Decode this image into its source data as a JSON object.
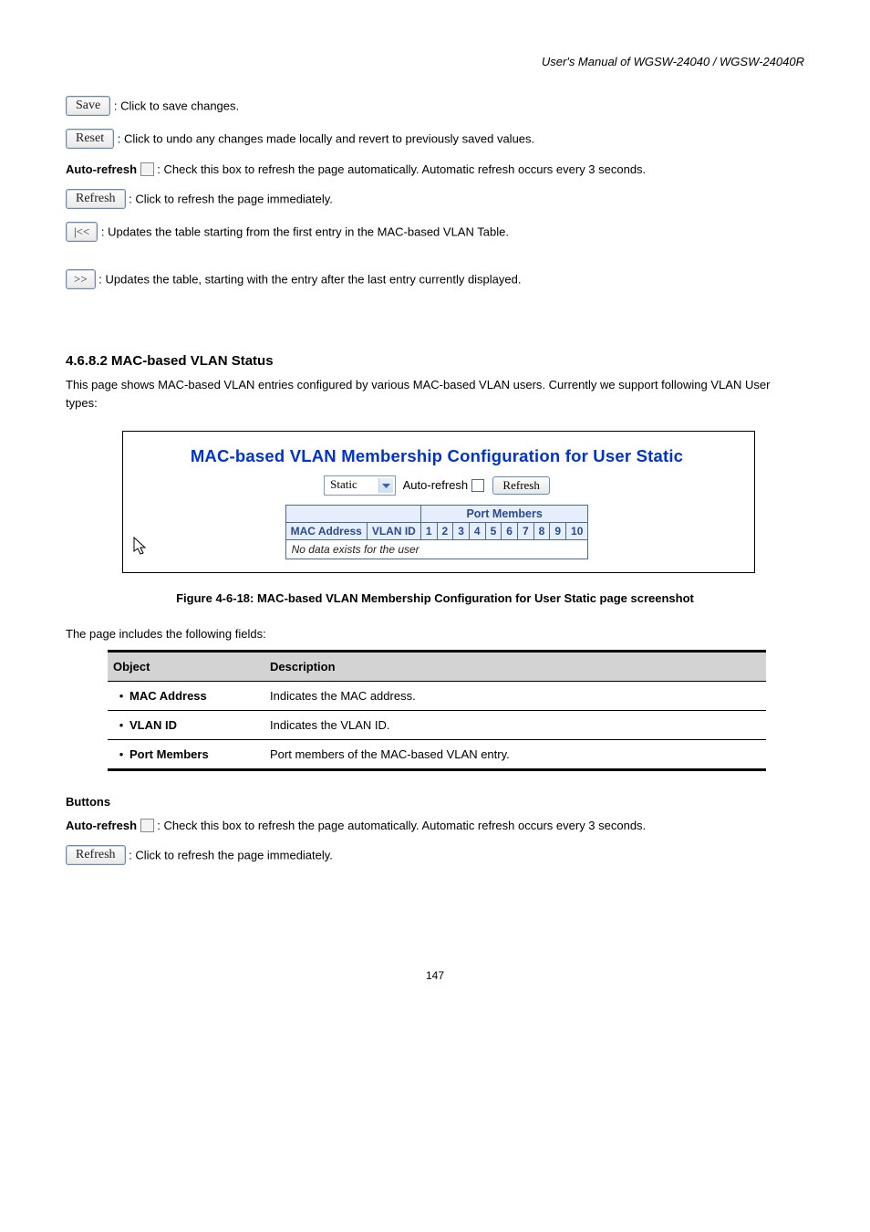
{
  "header": {
    "manual_line": "User's Manual of WGSW-24040 / WGSW-24040R"
  },
  "buttons_section": {
    "save_label": "Save",
    "save_desc": ": Click to save changes.",
    "reset_label": "Reset",
    "reset_desc": ": Click to undo any changes made locally and revert to previously saved values.",
    "autorefresh_label": "Auto-refresh",
    "autorefresh_desc": ": Check this box to refresh the page automatically. Automatic refresh occurs every 3 seconds.",
    "refresh_label": "Refresh",
    "refresh_desc": ": Click to refresh the page immediately.",
    "first_label": "|<<",
    "first_desc": ": Updates the table starting from the first entry in the MAC-based VLAN Table.",
    "next_label": ">>",
    "next_desc": ": Updates the table, starting with the entry after the last entry currently displayed."
  },
  "section": {
    "heading": "4.6.8.2 MAC-based VLAN Status",
    "para": "This page shows MAC-based VLAN entries configured by various MAC-based VLAN users. Currently we support following VLAN User types:",
    "figure_label": "Figure 4-6-18: MAC-based VLAN Membership Configuration for User Static page screenshot"
  },
  "figure": {
    "title": "MAC-based VLAN Membership Configuration for User Static",
    "select_value": "Static",
    "autorefresh_text": "Auto-refresh",
    "refresh_btn": "Refresh",
    "table": {
      "port_members_hdr": "Port Members",
      "mac_hdr": "MAC Address",
      "vlan_hdr": "VLAN ID",
      "ports": [
        "1",
        "2",
        "3",
        "4",
        "5",
        "6",
        "7",
        "8",
        "9",
        "10"
      ],
      "nodata": "No data exists for the user"
    }
  },
  "param_intro": "The page includes the following fields:",
  "param_table": {
    "hdr_obj": "Object",
    "hdr_desc": "Description",
    "rows": [
      {
        "obj": "MAC Address",
        "desc": "Indicates the MAC address."
      },
      {
        "obj": "VLAN ID",
        "desc": "Indicates the VLAN ID."
      },
      {
        "obj": "Port Members",
        "desc": "Port members of the MAC-based VLAN entry."
      }
    ]
  },
  "buttons2": {
    "heading": "Buttons",
    "autorefresh_label": "Auto-refresh",
    "autorefresh_desc": ": Check this box to refresh the page automatically. Automatic refresh occurs every 3 seconds.",
    "refresh_label": "Refresh",
    "refresh_desc": ": Click to refresh the page immediately."
  },
  "page_number": "147"
}
